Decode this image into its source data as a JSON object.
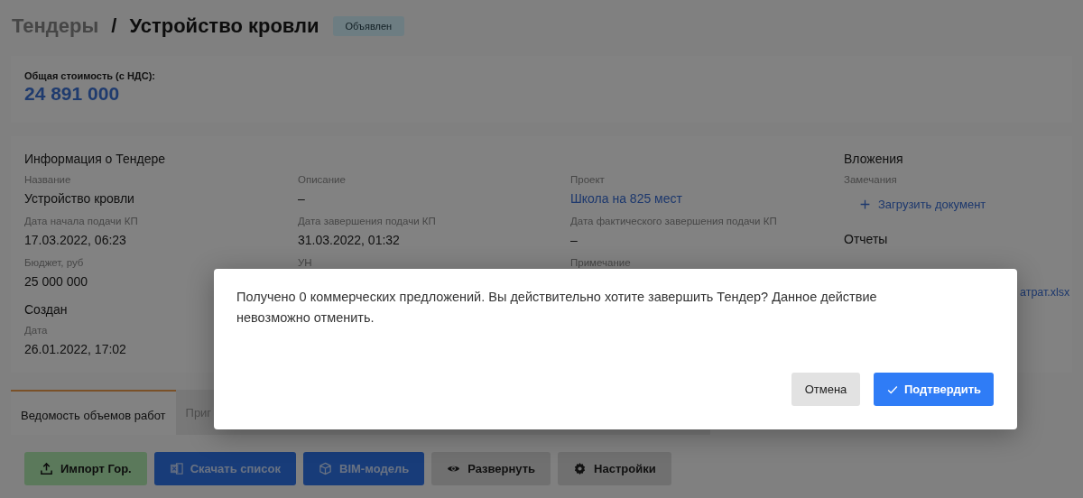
{
  "breadcrumb": {
    "section": "Тендеры",
    "separator": "/",
    "title": "Устройство кровли",
    "status": "Объявлен"
  },
  "summary": {
    "label": "Общая стоимость (с НДС):",
    "value": "24 891 000"
  },
  "info": {
    "heading": "Информация о Тендере",
    "columns": [
      [
        {
          "label": "Название",
          "value": "Устройство кровли"
        },
        {
          "label": "Дата начала подачи КП",
          "value": "17.03.2022, 06:23"
        },
        {
          "label": "Бюджет, руб",
          "value": "25 000 000"
        }
      ],
      [
        {
          "label": "Описание",
          "value": "–"
        },
        {
          "label": "Дата завершения подачи КП",
          "value": "31.03.2022, 01:32"
        },
        {
          "label": "УН"
        }
      ],
      [
        {
          "label": "Проект",
          "value": "Школа на 825 мест",
          "link": true
        },
        {
          "label": "Дата фактического завершения подачи КП",
          "value": "–"
        },
        {
          "label": "Примечание"
        }
      ]
    ],
    "created": {
      "heading": "Создан",
      "label": "Дата",
      "value": "26.01.2022, 17:02"
    }
  },
  "attachments": {
    "heading": "Вложения",
    "label": "Замечания",
    "upload": "Загрузить документ",
    "reports_heading": "Отчеты",
    "report_file": "атрат.xlsx"
  },
  "tabs": [
    {
      "label": "Ведомость объемов работ",
      "selected": true
    },
    {
      "label": "Приг",
      "selected": false
    }
  ],
  "toolbar": [
    {
      "label": "Импорт Гор.",
      "kind": "success"
    },
    {
      "label": "Скачать список",
      "kind": "primary"
    },
    {
      "label": "BIM-модель",
      "kind": "primary"
    },
    {
      "label": "Развернуть",
      "kind": "secondary"
    },
    {
      "label": "Настройки",
      "kind": "secondary"
    }
  ],
  "dialog": {
    "message": "Получено 0 коммерческих предложений. Вы действительно хотите завершить Тендер? Данное действие невозможно отменить.",
    "buttons": [
      {
        "label": "Отмена",
        "kind": "secondary"
      },
      {
        "label": "Подтвердить",
        "kind": "primary"
      }
    ]
  }
}
